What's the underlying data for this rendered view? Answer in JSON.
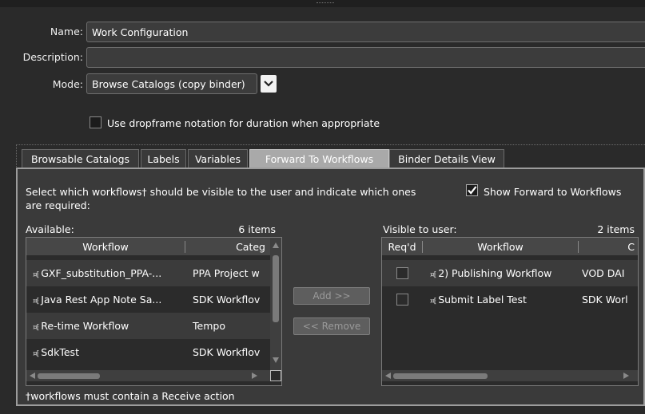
{
  "form": {
    "name_label": "Name:",
    "name_value": "Work Configuration",
    "description_label": "Description:",
    "description_value": "",
    "mode_label": "Mode:",
    "mode_value": "Browse Catalogs (copy binder)",
    "dropframe_label": "Use dropframe notation for duration when appropriate",
    "dropframe_checked": false
  },
  "tabs": [
    {
      "label": "Browsable Catalogs",
      "active": false
    },
    {
      "label": "Labels",
      "active": false
    },
    {
      "label": "Variables",
      "active": false
    },
    {
      "label": "Forward To Workflows",
      "active": true
    },
    {
      "label": "Binder Details View",
      "active": false
    }
  ],
  "forward": {
    "instructions_line1": "Select which workflows† should be visible to the user and indicate which ones",
    "instructions_line2": "are required:",
    "show_forward_label": "Show Forward to Workflows",
    "show_forward_checked": true,
    "footnote": "†workflows must contain a Receive action",
    "add_button": "Add >>",
    "remove_button": "<< Remove",
    "available": {
      "label": "Available:",
      "count": "6 items",
      "columns": [
        "Workflow",
        "Categ"
      ],
      "rows": [
        {
          "workflow": "GXF_substitution_PPA-...",
          "category": "PPA Project w"
        },
        {
          "workflow": "Java Rest App Note Sa...",
          "category": "SDK Workflov"
        },
        {
          "workflow": "Re-time Workflow",
          "category": "Tempo"
        },
        {
          "workflow": "SdkTest",
          "category": "SDK Workflov"
        }
      ]
    },
    "visible": {
      "label": "Visible to user:",
      "count": "2 items",
      "columns": [
        "Req'd",
        "Workflow",
        "C"
      ],
      "rows": [
        {
          "workflow": "2) Publishing Workflow",
          "category": "VOD DAI",
          "required": false
        },
        {
          "workflow": "Submit Label Test",
          "category": "SDK Worl",
          "required": false
        }
      ]
    }
  },
  "icons": {
    "workflow": "workflow-icon",
    "dropdown": "chevron-down-icon",
    "checkmark": "checkmark-icon"
  }
}
